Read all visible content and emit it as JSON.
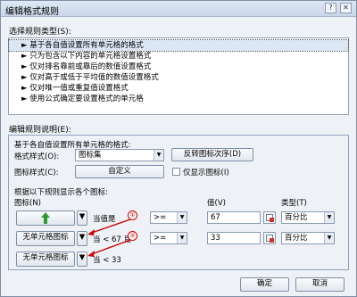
{
  "window": {
    "title": "编辑格式规则",
    "help_glyph": "?",
    "close_glyph": "✕"
  },
  "rule_type": {
    "label": "选择规则类型(S):",
    "items": [
      "► 基于各自值设置所有单元格的格式",
      "► 只为包含以下内容的单元格设置格式",
      "► 仅对排名靠前或靠后的数值设置格式",
      "► 仅对高于或低于平均值的数值设置格式",
      "► 仅对唯一值或重复值设置格式",
      "► 使用公式确定要设置格式的单元格"
    ],
    "selected_index": 0
  },
  "rule_desc": {
    "label": "编辑规则说明(E):",
    "intro": "基于各自值设置所有单元格的格式:",
    "format_style_label": "格式样式(O):",
    "format_style_value": "图标集",
    "reverse_button": "反转图标次序(D)",
    "icon_style_label": "图标样式(C):",
    "icon_style_value": "自定义",
    "show_icon_only_label": "仅显示图标(I)",
    "rules_header": "根据以下规则显示各个图标:",
    "icon_col_header": "图标(N)",
    "value_col_header": "值(V)",
    "type_col_header": "类型(T)",
    "rows": [
      {
        "icon_text": "",
        "condition_text": "当值是",
        "operator": ">=",
        "value": "67",
        "type": "百分比",
        "callout": "①"
      },
      {
        "icon_text": "无单元格图标",
        "condition_text": "当 < 67 且",
        "operator": ">=",
        "value": "33",
        "type": "百分比",
        "callout": "②"
      },
      {
        "icon_text": "无单元格图标",
        "condition_text": "当 < 33",
        "operator": "",
        "value": "",
        "type": "",
        "callout": ""
      }
    ]
  },
  "footer": {
    "ok": "确定",
    "cancel": "取消"
  },
  "colors": {
    "accent_green": "#2e9a2e",
    "callout_red": "#cc0000"
  }
}
